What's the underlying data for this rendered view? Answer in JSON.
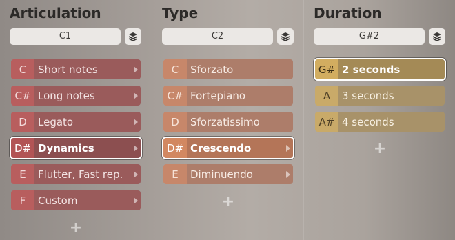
{
  "columns": [
    {
      "title": "Articulation",
      "key": "C1",
      "icon": "layers-icon",
      "items": [
        {
          "note": "C",
          "label": "Short notes",
          "arrow": true,
          "selected": false
        },
        {
          "note": "C#",
          "label": "Long notes",
          "arrow": true,
          "selected": false
        },
        {
          "note": "D",
          "label": "Legato",
          "arrow": true,
          "selected": false
        },
        {
          "note": "D#",
          "label": "Dynamics",
          "arrow": true,
          "selected": true
        },
        {
          "note": "E",
          "label": "Flutter, Fast rep.",
          "arrow": true,
          "selected": false
        },
        {
          "note": "F",
          "label": "Custom",
          "arrow": true,
          "selected": false
        }
      ],
      "add_label": "+"
    },
    {
      "title": "Type",
      "key": "C2",
      "icon": "layers-icon",
      "items": [
        {
          "note": "C",
          "label": "Sforzato",
          "arrow": false,
          "selected": false
        },
        {
          "note": "C#",
          "label": "Fortepiano",
          "arrow": false,
          "selected": false
        },
        {
          "note": "D",
          "label": "Sforzatissimo",
          "arrow": false,
          "selected": false
        },
        {
          "note": "D#",
          "label": "Crescendo",
          "arrow": true,
          "selected": true
        },
        {
          "note": "E",
          "label": "Diminuendo",
          "arrow": true,
          "selected": false
        }
      ],
      "add_label": "+"
    },
    {
      "title": "Duration",
      "key": "G#2",
      "icon": "layers-icon",
      "items": [
        {
          "note": "G#",
          "label": "2 seconds",
          "arrow": false,
          "selected": true
        },
        {
          "note": "A",
          "label": "3 seconds",
          "arrow": false,
          "selected": false
        },
        {
          "note": "A#",
          "label": "4 seconds",
          "arrow": false,
          "selected": false
        }
      ],
      "add_label": "+"
    }
  ]
}
